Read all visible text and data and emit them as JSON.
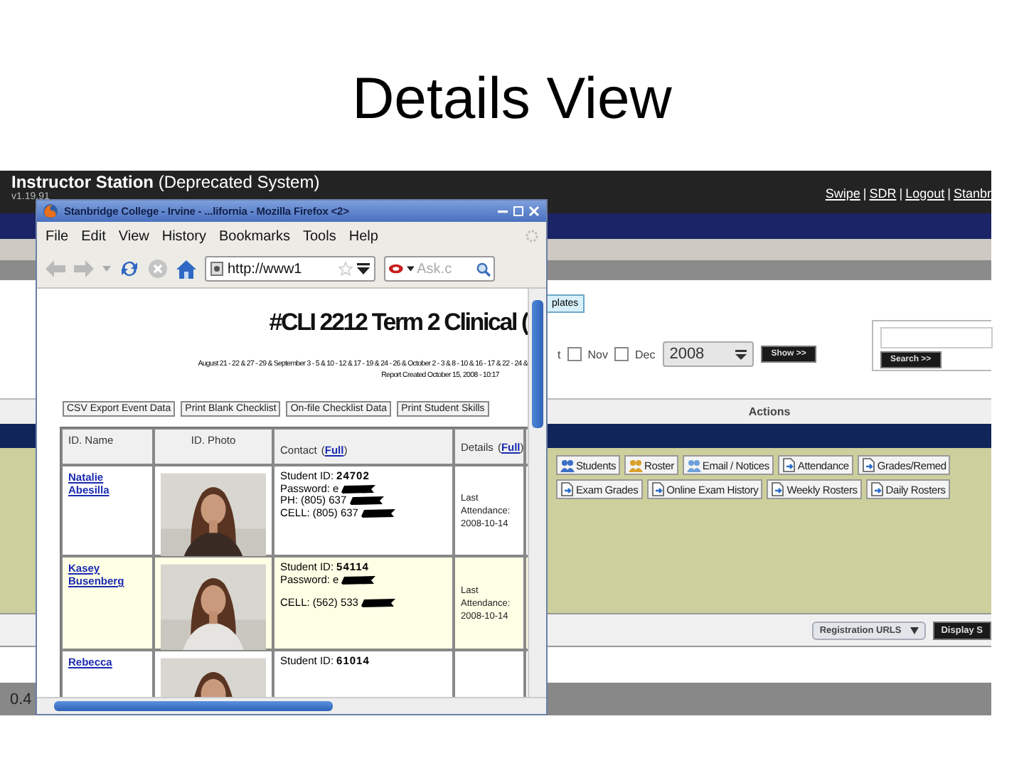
{
  "slide": {
    "title": "Details View"
  },
  "app": {
    "title": "Instructor Station",
    "subtitle": "(Deprecated System)",
    "version": "v1.19.91",
    "header_links": [
      {
        "kind": "link",
        "text": "Swipe"
      },
      {
        "kind": "separator",
        "text": "|"
      },
      {
        "kind": "link",
        "text": "SDR"
      },
      {
        "kind": "separator",
        "text": "|"
      },
      {
        "kind": "link",
        "text": "Logout"
      },
      {
        "kind": "separator",
        "text": "|"
      },
      {
        "kind": "link",
        "text": "Stanbr"
      }
    ],
    "templates_button": "plates",
    "month_fragment": "t",
    "months": [
      {
        "label": "Nov",
        "checked": false
      },
      {
        "label": "Dec",
        "checked": false
      }
    ],
    "year": "2008",
    "show_button": "Show >>",
    "search_button": "Search >>",
    "actions_header": "Actions",
    "action_rows": [
      [
        {
          "label": "Students",
          "kind": "group",
          "color": "#3b6fc4"
        },
        {
          "label": "Roster",
          "kind": "group",
          "color": "#d9a22e"
        },
        {
          "label": "Email / Notices",
          "kind": "group",
          "color": "#6f9fd8"
        },
        {
          "label": "Attendance",
          "kind": "document"
        },
        {
          "label": "Grades/Remed",
          "kind": "document"
        }
      ],
      [
        {
          "label": "Exam Grades",
          "kind": "document"
        },
        {
          "label": "Online Exam History",
          "kind": "document"
        },
        {
          "label": "Weekly Rosters",
          "kind": "document"
        },
        {
          "label": "Daily Rosters",
          "kind": "document"
        }
      ]
    ],
    "registration_select": "Registration URLS",
    "display_button": "Display S",
    "footer_text": "0.4"
  },
  "browser": {
    "title": "Stanbridge College - Irvine - ...lifornia - Mozilla Firefox <2>",
    "menu": [
      "File",
      "Edit",
      "View",
      "History",
      "Bookmarks",
      "Tools",
      "Help"
    ],
    "url": "http://www1",
    "search_placeholder": "Ask.c",
    "page": {
      "heading": "#CLI 2212 Term 2 Clinical (",
      "dates": "August 21 - 22 & 27 - 29 & September 3 - 5 & 10 - 12 & 17 - 19 & 24 - 26 & October 2 - 3 & 8 - 10 & 16 - 17 & 22 - 24 &",
      "report": "Report Created October 15, 2008 - 10:17",
      "buttons": [
        "CSV Export Event Data",
        "Print Blank Checklist",
        "On-file Checklist Data",
        "Print Student Skills"
      ],
      "columns": [
        {
          "label": "ID. Name"
        },
        {
          "label": "ID. Photo"
        },
        {
          "label": "Contact",
          "open": "(",
          "link": "Full",
          "close": ")"
        },
        {
          "label": "Details",
          "open": "(",
          "link": "Full",
          "close": ")"
        }
      ],
      "rows": [
        {
          "name": "Natalie Abesilla",
          "contact": [
            {
              "label": "Student ID:",
              "value": "24702"
            },
            {
              "label": "Password:",
              "value": "e",
              "redacted": true
            },
            {
              "label": "PH:",
              "value": "(805) 637",
              "redacted": true
            },
            {
              "label": "CELL:",
              "value": "(805) 637",
              "redacted": true
            }
          ],
          "details": [
            "Last Attendance:",
            "2008-10-14"
          ]
        },
        {
          "name": "Kasey Busenberg",
          "contact": [
            {
              "label": "Student ID:",
              "value": "54114"
            },
            {
              "label": "Password:",
              "value": "e",
              "redacted": true
            },
            {
              "label": "CELL:",
              "value": "(562) 533",
              "redacted": true,
              "gap_before": true
            }
          ],
          "details": [
            "Last Attendance:",
            "2008-10-14"
          ]
        },
        {
          "name": "Rebecca",
          "contact": [
            {
              "label": "Student ID:",
              "value": "61014"
            }
          ]
        }
      ]
    }
  }
}
